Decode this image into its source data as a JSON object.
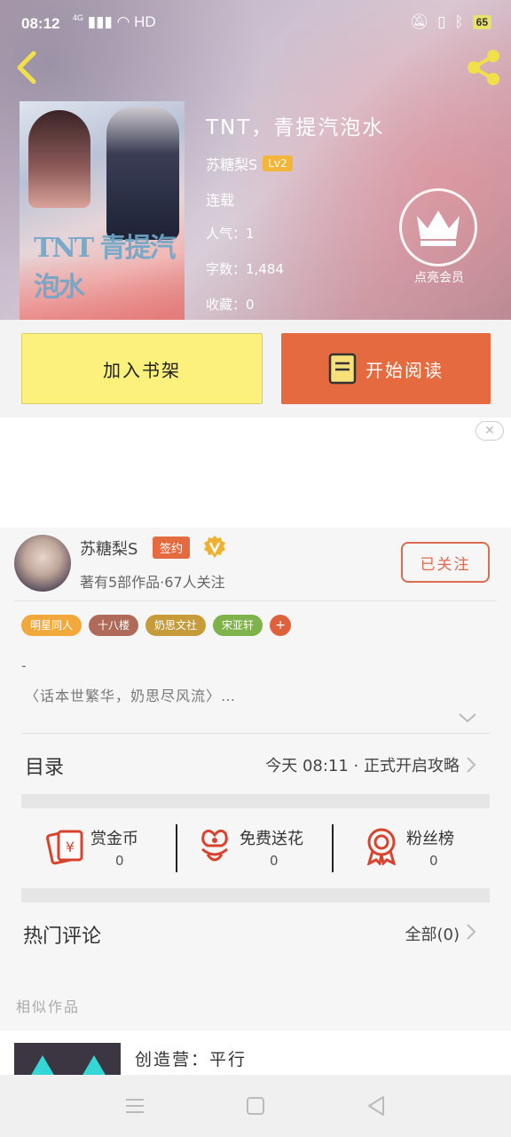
{
  "status_bar": {
    "time": "08:12",
    "network": "4G",
    "hd": "HD",
    "battery": "65"
  },
  "book": {
    "title": "TNT，青提汽泡水",
    "author": "苏糖梨S",
    "level": "Lv2",
    "status": "连载",
    "popularity": "人气：1",
    "word_count": "字数：1,484",
    "favorites": "收藏：0",
    "vip_label": "点亮会员",
    "cover_text": "TNT 青提汽泡水"
  },
  "actions": {
    "add_shelf": "加入书架",
    "start_read": "开始阅读"
  },
  "ad": {
    "close": "✕"
  },
  "author": {
    "name": "苏糖梨S",
    "sign_badge": "签约",
    "works": "著有5部作品·67人关注",
    "follow": "已关注"
  },
  "tags": [
    {
      "label": "明星同人",
      "color": "#f0a93a"
    },
    {
      "label": "十八楼",
      "color": "#b06a5a"
    },
    {
      "label": "奶思文社",
      "color": "#c79a3a"
    },
    {
      "label": "宋亚轩",
      "color": "#7fb24a"
    }
  ],
  "tag_more": "+",
  "summary": {
    "dash": "-",
    "text": "〈话本世繁华，奶思尽风流〉…"
  },
  "catalog": {
    "title": "目录",
    "latest": "今天 08:11 · 正式开启攻略"
  },
  "stats": [
    {
      "label": "赏金币",
      "value": "0"
    },
    {
      "label": "免费送花",
      "value": "0"
    },
    {
      "label": "粉丝榜",
      "value": "0"
    }
  ],
  "comments": {
    "title": "热门评论",
    "all": "全部(0)"
  },
  "similar": {
    "heading": "相似作品",
    "first_title": "创造营：平行"
  },
  "colors": {
    "accent": "#e66a3f",
    "shelf": "#fbf17c",
    "icon_red": "#d9432e"
  }
}
